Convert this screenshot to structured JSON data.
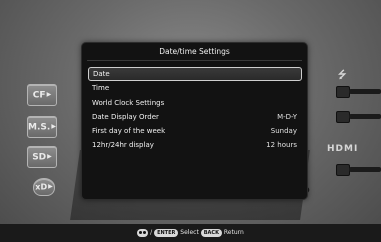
{
  "dialog": {
    "title": "Date/time Settings",
    "items": [
      {
        "label": "Date",
        "value": "",
        "selected": true
      },
      {
        "label": "Time",
        "value": ""
      },
      {
        "label": "World Clock Settings",
        "value": ""
      },
      {
        "label": "Date Display Order",
        "value": "M-D-Y"
      },
      {
        "label": "First day of the week",
        "value": "Sunday"
      },
      {
        "label": "12hr/24hr display",
        "value": "12 hours"
      }
    ]
  },
  "slots": [
    {
      "label": "CF",
      "icon": "arrow-right-icon"
    },
    {
      "label": "M.S.",
      "icon": "arrow-right-icon"
    },
    {
      "label": "SD",
      "icon": "arrow-right-icon"
    },
    {
      "label": "xD",
      "icon": "arrow-right-icon"
    }
  ],
  "ports": {
    "usb_symbol": "⭍",
    "hdmi_label": "HDMI"
  },
  "hints": {
    "enter_key": "ENTER",
    "select_text": "Select",
    "back_key": "BACK",
    "return_text": "Return"
  },
  "colors": {
    "dialog_bg": "#121212",
    "selection_border": "#cfcfcf",
    "background": "#6a6a6a"
  }
}
